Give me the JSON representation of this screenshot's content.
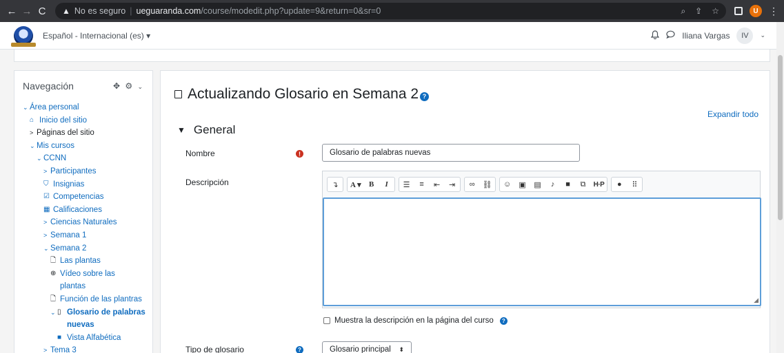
{
  "browser": {
    "security_label": "No es seguro",
    "url_host": "ueguaranda.com",
    "url_path": "/course/modedit.php?update=9&return=0&sr=0",
    "profile_initial": "U"
  },
  "topbar": {
    "language": "Español - Internacional (es) ▾",
    "user_name": "Iliana Vargas",
    "user_initials": "IV"
  },
  "nav": {
    "title": "Navegación",
    "items": [
      {
        "label": "Área personal",
        "caret": "⌄",
        "icon": "",
        "indent": 0
      },
      {
        "label": "Inicio del sitio",
        "caret": "",
        "icon": "home-icon",
        "indent": 1
      },
      {
        "label": "Páginas del sitio",
        "caret": ">",
        "icon": "",
        "indent": 1
      },
      {
        "label": "Mis cursos",
        "caret": "⌄",
        "icon": "",
        "indent": 1
      },
      {
        "label": "CCNN",
        "caret": "⌄",
        "icon": "",
        "indent": 2
      },
      {
        "label": "Participantes",
        "caret": ">",
        "icon": "",
        "indent": 3
      },
      {
        "label": "Insignias",
        "caret": "",
        "icon": "shield-icon",
        "indent": 3
      },
      {
        "label": "Competencias",
        "caret": "",
        "icon": "checkbox-icon",
        "indent": 3
      },
      {
        "label": "Calificaciones",
        "caret": "",
        "icon": "table-icon",
        "indent": 3
      },
      {
        "label": "Ciencias Naturales",
        "caret": ">",
        "icon": "",
        "indent": 3
      },
      {
        "label": "Semana 1",
        "caret": ">",
        "icon": "",
        "indent": 3
      },
      {
        "label": "Semana 2",
        "caret": "⌄",
        "icon": "",
        "indent": 3
      },
      {
        "label": "Las plantas",
        "caret": "",
        "icon": "file-icon",
        "indent": 4
      },
      {
        "label": "Vídeo sobre las plantas",
        "caret": "",
        "icon": "globe-icon",
        "indent": 4
      },
      {
        "label": "Función de las plantras",
        "caret": "",
        "icon": "file-icon",
        "indent": 4
      },
      {
        "label": "Glosario de palabras nuevas",
        "caret": "⌄",
        "icon": "glossary-icon",
        "indent": 4
      },
      {
        "label": "Vista Alfabética",
        "caret": "",
        "icon": "square-icon",
        "indent": 5
      },
      {
        "label": "Tema 3",
        "caret": ">",
        "icon": "",
        "indent": 3
      }
    ]
  },
  "main": {
    "title": "Actualizando Glosario en Semana 2",
    "expand_all": "Expandir todo",
    "section": "General",
    "name_label": "Nombre",
    "name_value": "Glosario de palabras nuevas",
    "description_label": "Descripción",
    "show_description_label": "Muestra la descripción en la página del curso",
    "glossary_type_label": "Tipo de glosario",
    "glossary_type_value": "Glosario principal"
  },
  "toolbar_icons": [
    [
      "collapse-icon"
    ],
    [
      "font-style-icon",
      "bold-icon",
      "italic-icon"
    ],
    [
      "unordered-list-icon",
      "ordered-list-icon",
      "outdent-icon",
      "indent-icon"
    ],
    [
      "link-icon",
      "unlink-icon"
    ],
    [
      "emoji-icon",
      "image-icon",
      "media-icon",
      "record-audio-icon",
      "record-video-icon",
      "manage-files-icon",
      "h5p-icon"
    ],
    [
      "accessibility-checker-icon",
      "screenreader-helper-icon"
    ]
  ]
}
